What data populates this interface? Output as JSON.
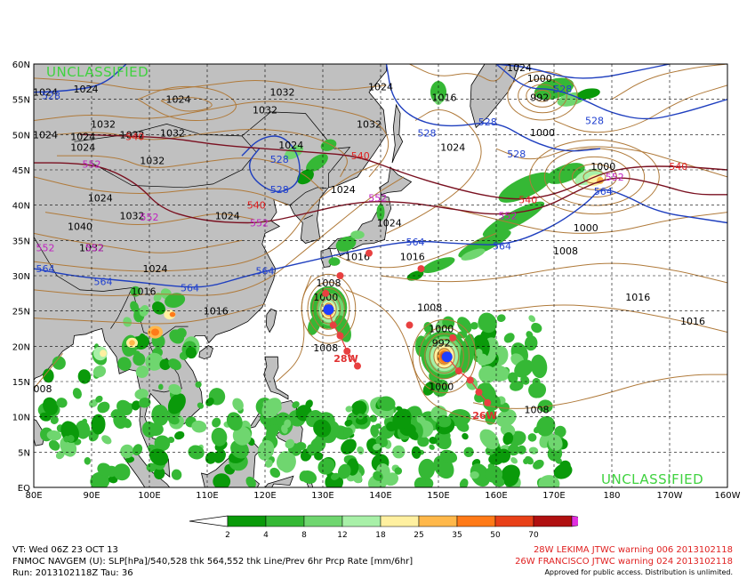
{
  "map": {
    "lat_labels": [
      "60N",
      "55N",
      "50N",
      "45N",
      "40N",
      "35N",
      "30N",
      "25N",
      "20N",
      "15N",
      "10N",
      "5N",
      "EQ"
    ],
    "lon_labels": [
      "80E",
      "90E",
      "100E",
      "110E",
      "120E",
      "130E",
      "140E",
      "150E",
      "160E",
      "170E",
      "180",
      "170W",
      "160W"
    ],
    "classification": "UNCLASSIFIED",
    "colors": {
      "land": "#c0c0c0",
      "ocean": "#ffffff",
      "slp_contour": "#b07a3a",
      "thk_528_564": "#1f3fbf",
      "thk_540_552": "#7a1020",
      "thk_552_label": "#c020c0",
      "thk_540_label": "#e02020"
    },
    "slp_labels": [
      {
        "text": "1024",
        "lon": 89,
        "lat": 56.5
      },
      {
        "text": "1024",
        "lon": 105,
        "lat": 55
      },
      {
        "text": "1032",
        "lon": 120,
        "lat": 53.5
      },
      {
        "text": "1032",
        "lon": 123,
        "lat": 56
      },
      {
        "text": "1032",
        "lon": 92,
        "lat": 51.5
      },
      {
        "text": "1032",
        "lon": 97,
        "lat": 50
      },
      {
        "text": "1032",
        "lon": 104,
        "lat": 50.2
      },
      {
        "text": "1024",
        "lon": 82,
        "lat": 50
      },
      {
        "text": "1024",
        "lon": 88.5,
        "lat": 49.7
      },
      {
        "text": "1024",
        "lon": 88.5,
        "lat": 48.2
      },
      {
        "text": "1032",
        "lon": 100.5,
        "lat": 46.3
      },
      {
        "text": "1024",
        "lon": 124.5,
        "lat": 48.5
      },
      {
        "text": "1032",
        "lon": 138,
        "lat": 51.5
      },
      {
        "text": "1024",
        "lon": 140,
        "lat": 56.8
      },
      {
        "text": "1024",
        "lon": 164,
        "lat": 59.5
      },
      {
        "text": "1016",
        "lon": 151,
        "lat": 55.3
      },
      {
        "text": "1024",
        "lon": 152.5,
        "lat": 48.2
      },
      {
        "text": "1000",
        "lon": 167.5,
        "lat": 58
      },
      {
        "text": "992",
        "lon": 167.5,
        "lat": 55.3
      },
      {
        "text": "1000",
        "lon": 168,
        "lat": 50.3
      },
      {
        "text": "1000",
        "lon": 178.5,
        "lat": 45.5
      },
      {
        "text": "1000",
        "lon": 175.5,
        "lat": 36.8
      },
      {
        "text": "1008",
        "lon": 172,
        "lat": 33.5
      },
      {
        "text": "1016",
        "lon": 184.5,
        "lat": 27
      },
      {
        "text": "1016",
        "lon": 194,
        "lat": 23.6
      },
      {
        "text": "1024",
        "lon": 133.5,
        "lat": 42.2
      },
      {
        "text": "1024",
        "lon": 141.5,
        "lat": 37.5
      },
      {
        "text": "1024",
        "lon": 91.5,
        "lat": 41
      },
      {
        "text": "1024",
        "lon": 113.5,
        "lat": 38.5
      },
      {
        "text": "1032",
        "lon": 97,
        "lat": 38.5
      },
      {
        "text": "1040",
        "lon": 88,
        "lat": 37
      },
      {
        "text": "1032",
        "lon": 90,
        "lat": 34
      },
      {
        "text": "1024",
        "lon": 101,
        "lat": 31
      },
      {
        "text": "1016",
        "lon": 99,
        "lat": 27.8
      },
      {
        "text": "1016",
        "lon": 111.5,
        "lat": 25
      },
      {
        "text": "1016",
        "lon": 136,
        "lat": 32.7
      },
      {
        "text": "1016",
        "lon": 145.5,
        "lat": 32.7
      },
      {
        "text": "1008",
        "lon": 131,
        "lat": 29
      },
      {
        "text": "1000",
        "lon": 130.5,
        "lat": 27
      },
      {
        "text": "1008",
        "lon": 148.5,
        "lat": 25.5
      },
      {
        "text": "1000",
        "lon": 150.5,
        "lat": 22.5
      },
      {
        "text": "992",
        "lon": 150.5,
        "lat": 20.5
      },
      {
        "text": "1008",
        "lon": 130.5,
        "lat": 19.8
      },
      {
        "text": "1000",
        "lon": 150.5,
        "lat": 14.3
      },
      {
        "text": "1008",
        "lon": 167,
        "lat": 11
      },
      {
        "text": "1008",
        "lon": 81,
        "lat": 14
      },
      {
        "text": "1024",
        "lon": 82,
        "lat": 56
      }
    ],
    "thk_labels": [
      {
        "text": "528",
        "lon": 83,
        "lat": 55.5,
        "color": "#2040d0"
      },
      {
        "text": "528",
        "lon": 122.5,
        "lat": 46.5,
        "color": "#2040d0"
      },
      {
        "text": "528",
        "lon": 122.5,
        "lat": 42.2,
        "color": "#2040d0"
      },
      {
        "text": "528",
        "lon": 148,
        "lat": 50.2,
        "color": "#2040d0"
      },
      {
        "text": "528",
        "lon": 158.5,
        "lat": 51.8,
        "color": "#2040d0"
      },
      {
        "text": "528",
        "lon": 163.5,
        "lat": 47.3,
        "color": "#2040d0"
      },
      {
        "text": "528",
        "lon": 171.5,
        "lat": 56.5,
        "color": "#2040d0"
      },
      {
        "text": "528",
        "lon": 177,
        "lat": 52,
        "color": "#2040d0"
      },
      {
        "text": "564",
        "lon": 178.5,
        "lat": 42,
        "color": "#2040d0"
      },
      {
        "text": "564",
        "lon": 146,
        "lat": 34.8,
        "color": "#2040d0"
      },
      {
        "text": "564",
        "lon": 161,
        "lat": 34.2,
        "color": "#2040d0"
      },
      {
        "text": "564",
        "lon": 120,
        "lat": 30.7,
        "color": "#2040d0"
      },
      {
        "text": "564",
        "lon": 107,
        "lat": 28.3,
        "color": "#2040d0"
      },
      {
        "text": "564",
        "lon": 92,
        "lat": 29.2,
        "color": "#2040d0"
      },
      {
        "text": "564",
        "lon": 82,
        "lat": 31,
        "color": "#2040d0"
      },
      {
        "text": "540",
        "lon": 97.5,
        "lat": 49.7,
        "color": "#e02020"
      },
      {
        "text": "540",
        "lon": 136.5,
        "lat": 47,
        "color": "#e02020"
      },
      {
        "text": "540",
        "lon": 165.5,
        "lat": 40.8,
        "color": "#e02020"
      },
      {
        "text": "540",
        "lon": 191.5,
        "lat": 45.5,
        "color": "#e02020"
      },
      {
        "text": "540",
        "lon": 118.5,
        "lat": 40,
        "color": "#e02020"
      },
      {
        "text": "552",
        "lon": 90,
        "lat": 45.8,
        "color": "#c020c0"
      },
      {
        "text": "552",
        "lon": 100,
        "lat": 38.3,
        "color": "#c020c0"
      },
      {
        "text": "552",
        "lon": 82,
        "lat": 34,
        "color": "#c020c0"
      },
      {
        "text": "552",
        "lon": 90.5,
        "lat": 34,
        "color": "#c020c0"
      },
      {
        "text": "552",
        "lon": 119,
        "lat": 37.5,
        "color": "#c020c0"
      },
      {
        "text": "552",
        "lon": 139.5,
        "lat": 41,
        "color": "#c020c0"
      },
      {
        "text": "552",
        "lon": 162,
        "lat": 38.5,
        "color": "#c020c0"
      },
      {
        "text": "552",
        "lon": 180.5,
        "lat": 44,
        "color": "#c020c0"
      }
    ],
    "storms": [
      {
        "id": "28W",
        "name": "LEKIMA",
        "lon": 131,
        "lat": 25.2,
        "label_lon": 134,
        "label_lat": 17.8,
        "track": [
          [
            131,
            25.2
          ],
          [
            131.8,
            23
          ],
          [
            133,
            21.5
          ],
          [
            134.2,
            19.3
          ],
          [
            136,
            17.2
          ]
        ]
      },
      {
        "id": "26W",
        "name": "FRANCISCO",
        "lon": 151.5,
        "lat": 18.5,
        "label_lon": 158,
        "label_lat": 9.7,
        "track": [
          [
            151.5,
            18.5
          ],
          [
            153.5,
            16.5
          ],
          [
            155.5,
            15.2
          ],
          [
            157,
            13.5
          ],
          [
            158.5,
            12
          ]
        ]
      }
    ],
    "forecast_dots": [
      [
        138,
        33.2
      ],
      [
        147,
        31
      ],
      [
        145,
        23
      ],
      [
        133,
        30
      ],
      [
        152.5,
        21.2
      ],
      [
        130.5,
        27.5
      ]
    ]
  },
  "colorbar": {
    "thresholds": [
      "2",
      "4",
      "8",
      "12",
      "18",
      "25",
      "35",
      "50",
      "70"
    ],
    "colors": [
      "#0a9a0a",
      "#35b835",
      "#6fd66f",
      "#a8f0a8",
      "#fff0a0",
      "#ffb84a",
      "#ff7a18",
      "#e84018",
      "#b01010",
      "#8c0808",
      "#e030e0"
    ]
  },
  "info": {
    "vt": "VT: Wed 06Z 23 OCT 13",
    "model": "FNMOC NAVGEM (U): SLP[hPa]/540,528 thk 564,552 thk Line/Prev 6hr Prcp Rate [mm/6hr]",
    "run": "Run: 2013102118Z Tau: 36",
    "warning1": "28W LEKIMA JTWC warning 006 2013102118",
    "warning2": "26W FRANCISCO JTWC warning 024 2013102118",
    "disclaimer": "Approved for public access. Distribution is unlimited."
  }
}
